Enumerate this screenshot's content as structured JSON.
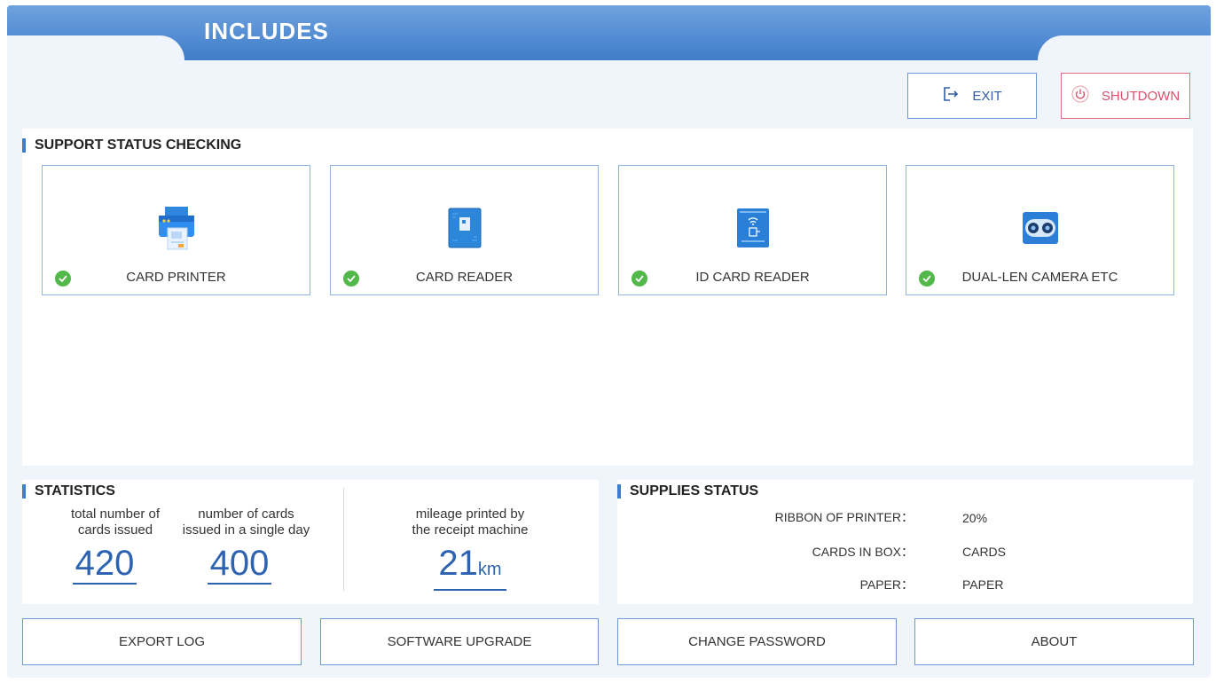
{
  "header": {
    "title": "INCLUDES"
  },
  "top_buttons": {
    "exit_label": "EXIT",
    "shutdown_label": "SHUTDOWN"
  },
  "support": {
    "title": "SUPPORT STATUS CHECKING",
    "devices": [
      {
        "label": "CARD PRINTER",
        "icon": "printer-icon",
        "status": "ok"
      },
      {
        "label": "CARD READER",
        "icon": "card-reader-icon",
        "status": "ok"
      },
      {
        "label": "ID CARD READER",
        "icon": "id-card-reader-icon",
        "status": "ok"
      },
      {
        "label": "DUAL-LEN CAMERA ETC",
        "icon": "camera-icon",
        "status": "ok"
      }
    ]
  },
  "statistics": {
    "title": "STATISTICS",
    "total_label_1": "total number of",
    "total_label_2": "cards issued",
    "total_value": "420",
    "daily_label_1": "number of cards",
    "daily_label_2": "issued in a single day",
    "daily_value": "400",
    "mileage_label_1": "mileage printed by",
    "mileage_label_2": "the receipt machine",
    "mileage_value": "21",
    "mileage_unit": "km"
  },
  "supplies": {
    "title": "SUPPLIES STATUS",
    "items": [
      {
        "key": "RIBBON OF PRINTER：",
        "value": "20%"
      },
      {
        "key": "CARDS IN BOX：",
        "value": "CARDS"
      },
      {
        "key": "PAPER：",
        "value": "PAPER"
      }
    ]
  },
  "bottom_buttons": {
    "export_log": "EXPORT LOG",
    "software_upgrade": "SOFTWARE UPGRADE",
    "change_password": "CHANGE PASSWORD",
    "about": "ABOUT"
  },
  "colors": {
    "accent": "#3f7cc9",
    "ok": "#52b84a",
    "danger": "#d8506a"
  }
}
